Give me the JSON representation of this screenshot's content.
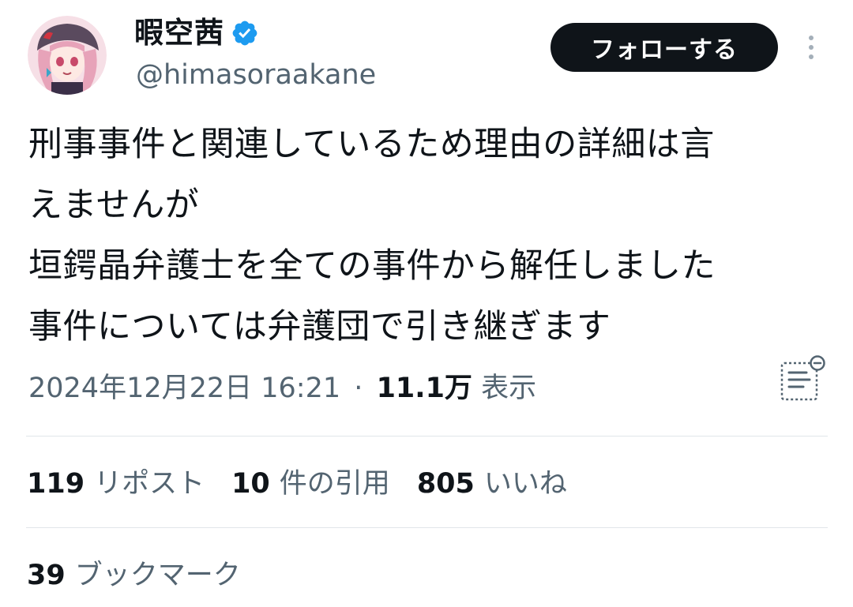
{
  "profile": {
    "display_name": "暇空茜",
    "handle": "@himasoraakane",
    "verified": true,
    "follow_label": "フォローする"
  },
  "tweet": {
    "lines": [
      "刑事事件と関連しているため理由の詳細は言",
      "えませんが",
      "垣鍔晶弁護士を全ての事件から解任しました",
      "事件については弁護団で引き継ぎます"
    ],
    "timestamp": "2024年12月22日 16:21",
    "separator": "·",
    "views_count": "11.1万",
    "views_label": "表示"
  },
  "stats": {
    "reposts": {
      "count": "119",
      "label": "リポスト"
    },
    "quotes": {
      "count": "10",
      "label": "件の引用"
    },
    "likes": {
      "count": "805",
      "label": "いいね"
    },
    "bookmarks": {
      "count": "39",
      "label": "ブックマーク"
    }
  },
  "icons": {
    "verified": "verified-badge-icon",
    "more": "more-vertical-icon",
    "translate": "translate-icon"
  },
  "colors": {
    "text": "#0f1419",
    "secondary": "#536471",
    "verified": "#1d9bf0",
    "button_bg": "#0f1419",
    "divider": "#e1e6ea"
  }
}
